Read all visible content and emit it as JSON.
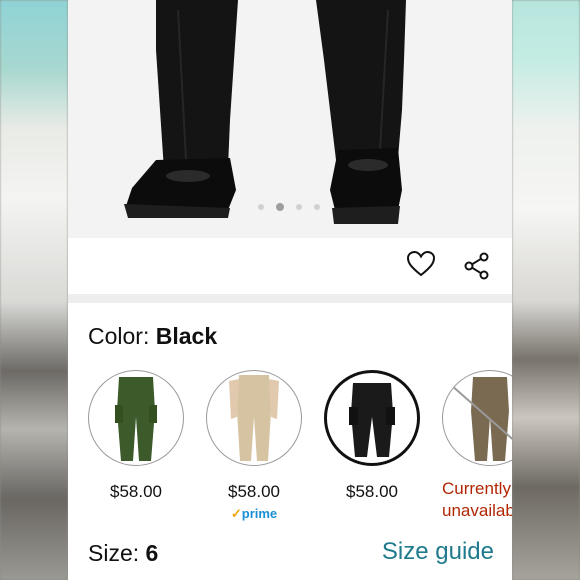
{
  "colors": {
    "brand_link": "#1e7a8c",
    "unavailable": "#b12704",
    "prime": "#1a8fd6"
  },
  "gallery": {
    "image_description_icon": "product-photo",
    "dot_count": 4,
    "active_dot": 2
  },
  "actions": {
    "wishlist_icon": "heart-icon",
    "share_icon": "share-icon"
  },
  "color_selector": {
    "label": "Color:",
    "selected_value": "Black",
    "options": [
      {
        "name": "Green",
        "price": "$58.00",
        "prime": ""
      },
      {
        "name": "Khaki",
        "price": "$58.00",
        "prime": "prime"
      },
      {
        "name": "Black",
        "price": "$58.00",
        "prime": ""
      },
      {
        "name": "Brown",
        "price": "",
        "unavailable_line1": "Currently",
        "unavailable_line2": "unavailable"
      }
    ]
  },
  "size_selector": {
    "label": "Size:",
    "selected_value": "6",
    "guide_link": "Size guide"
  }
}
